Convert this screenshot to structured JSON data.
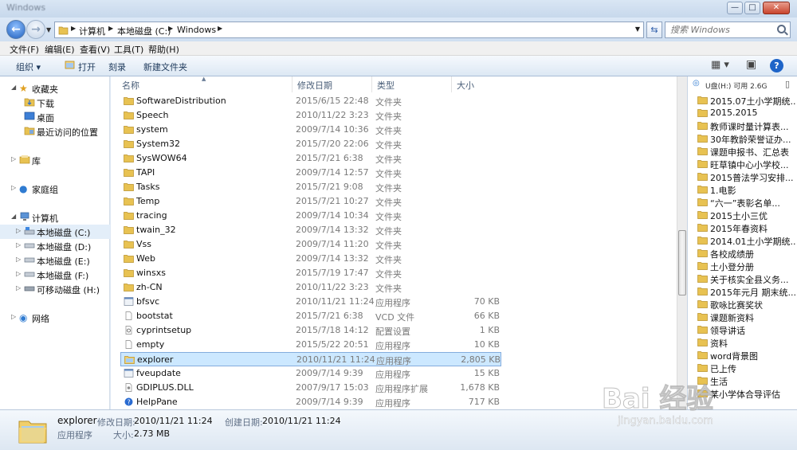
{
  "window": {
    "title": "Windows"
  },
  "address": {
    "crumbs": [
      "计算机",
      "本地磁盘 (C:)",
      "Windows"
    ],
    "search_placeholder": "搜索 Windows"
  },
  "menu": [
    "文件(F)",
    "编辑(E)",
    "查看(V)",
    "工具(T)",
    "帮助(H)"
  ],
  "toolbar": {
    "organize": "组织 ▾",
    "open": "打开",
    "burn": "刻录",
    "new_folder": "新建文件夹"
  },
  "nav": {
    "favorites": "收藏夹",
    "fav_items": [
      "下载",
      "桌面",
      "最近访问的位置"
    ],
    "libraries": "库",
    "homegroup": "家庭组",
    "computer": "计算机",
    "drives": [
      "本地磁盘 (C:)",
      "本地磁盘 (D:)",
      "本地磁盘 (E:)",
      "本地磁盘 (F:)",
      "可移动磁盘 (H:)"
    ],
    "network": "网络"
  },
  "columns": {
    "name": "名称",
    "date": "修改日期",
    "type": "类型",
    "size": "大小"
  },
  "files": [
    {
      "name": "SoftwareDistribution",
      "date": "2015/6/15 22:48",
      "type": "文件夹",
      "size": "",
      "icon": "folder"
    },
    {
      "name": "Speech",
      "date": "2010/11/22 3:23",
      "type": "文件夹",
      "size": "",
      "icon": "folder"
    },
    {
      "name": "system",
      "date": "2009/7/14 10:36",
      "type": "文件夹",
      "size": "",
      "icon": "folder"
    },
    {
      "name": "System32",
      "date": "2015/7/20 22:06",
      "type": "文件夹",
      "size": "",
      "icon": "folder"
    },
    {
      "name": "SysWOW64",
      "date": "2015/7/21 6:38",
      "type": "文件夹",
      "size": "",
      "icon": "folder"
    },
    {
      "name": "TAPI",
      "date": "2009/7/14 12:57",
      "type": "文件夹",
      "size": "",
      "icon": "folder"
    },
    {
      "name": "Tasks",
      "date": "2015/7/21 9:08",
      "type": "文件夹",
      "size": "",
      "icon": "folder"
    },
    {
      "name": "Temp",
      "date": "2015/7/21 10:27",
      "type": "文件夹",
      "size": "",
      "icon": "folder"
    },
    {
      "name": "tracing",
      "date": "2009/7/14 10:34",
      "type": "文件夹",
      "size": "",
      "icon": "folder"
    },
    {
      "name": "twain_32",
      "date": "2009/7/14 13:32",
      "type": "文件夹",
      "size": "",
      "icon": "folder"
    },
    {
      "name": "Vss",
      "date": "2009/7/14 11:20",
      "type": "文件夹",
      "size": "",
      "icon": "folder"
    },
    {
      "name": "Web",
      "date": "2009/7/14 13:32",
      "type": "文件夹",
      "size": "",
      "icon": "folder"
    },
    {
      "name": "winsxs",
      "date": "2015/7/19 17:47",
      "type": "文件夹",
      "size": "",
      "icon": "folder"
    },
    {
      "name": "zh-CN",
      "date": "2010/11/22 3:23",
      "type": "文件夹",
      "size": "",
      "icon": "folder"
    },
    {
      "name": "bfsvc",
      "date": "2010/11/21 11:24",
      "type": "应用程序",
      "size": "70 KB",
      "icon": "exe"
    },
    {
      "name": "bootstat",
      "date": "2015/7/21 6:38",
      "type": "VCD 文件",
      "size": "66 KB",
      "icon": "file"
    },
    {
      "name": "cyprintsetup",
      "date": "2015/7/18 14:12",
      "type": "配置设置",
      "size": "1 KB",
      "icon": "ini"
    },
    {
      "name": "empty",
      "date": "2015/5/22 20:51",
      "type": "应用程序",
      "size": "10 KB",
      "icon": "file"
    },
    {
      "name": "explorer",
      "date": "2010/11/21 11:24",
      "type": "应用程序",
      "size": "2,805 KB",
      "icon": "explorer"
    },
    {
      "name": "fveupdate",
      "date": "2009/7/14 9:39",
      "type": "应用程序",
      "size": "15 KB",
      "icon": "exe"
    },
    {
      "name": "GDIPLUS.DLL",
      "date": "2007/9/17 15:03",
      "type": "应用程序扩展",
      "size": "1,678 KB",
      "icon": "dll"
    },
    {
      "name": "HelpPane",
      "date": "2009/7/14 9:39",
      "type": "应用程序",
      "size": "717 KB",
      "icon": "help"
    }
  ],
  "selected_index": 18,
  "usb": {
    "header": "U盘(H:) 可用 2.6G",
    "items": [
      "2015.07土小学期统...",
      "2015.2015",
      "教师课时量计算表...",
      "30年教龄荣誉证办...",
      "课题申报书、汇总表",
      "旺草镇中心小学校...",
      "2015普法学习安排...",
      "1.电影",
      "“六一”表彰名单...",
      "2015土小三优",
      "2015年春资料",
      "2014.01土小学期统...",
      "各校成绩册",
      "土小登分册",
      "关于核实全县义务...",
      "2015年元月 期末统...",
      "歌咏比赛奖状",
      "课题新资料",
      "领导讲话",
      "资料",
      "word背景图",
      "已上传",
      "生活",
      "某小学体合导评估"
    ]
  },
  "details": {
    "name": "explorer",
    "mod_label": "修改日期:",
    "mod_value": "2010/11/21 11:24",
    "created_label": "创建日期:",
    "created_value": "2010/11/21 11:24",
    "type": "应用程序",
    "size_label": "大小:",
    "size_value": "2.73 MB"
  },
  "watermark": {
    "brand": "Bai 经验",
    "url": "jingyan.baidu.com"
  },
  "colors": {
    "folder": "#e8c252",
    "selection": "#cce8ff",
    "accent": "#1e64c8"
  }
}
